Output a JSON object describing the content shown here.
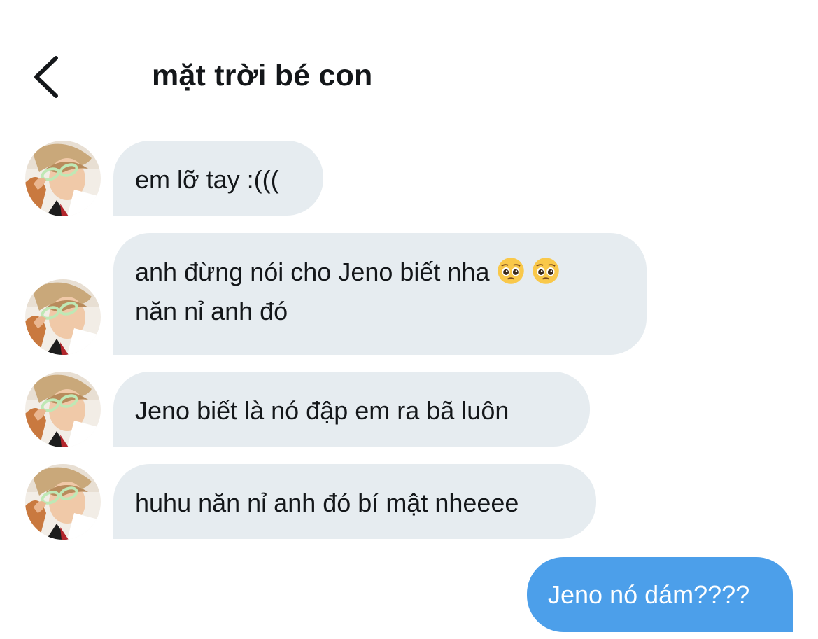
{
  "header": {
    "back_icon": "chevron-left-icon",
    "title": "mặt trời bé con"
  },
  "messages": [
    {
      "sender": "other",
      "lines": [
        "em lỡ tay :((("
      ]
    },
    {
      "sender": "other",
      "lines": [
        "anh đừng nói cho Jeno biết nha",
        "năn nỉ anh đó"
      ],
      "emoji": [
        "pleading-face-icon",
        "pleading-face-icon"
      ]
    },
    {
      "sender": "other",
      "lines": [
        "Jeno biết là nó đập em ra bã luôn"
      ]
    },
    {
      "sender": "other",
      "lines": [
        "huhu năn nỉ anh đó bí mật nheeee"
      ]
    },
    {
      "sender": "me",
      "lines": [
        "Jeno nó dám????"
      ]
    }
  ],
  "colors": {
    "incoming_bubble": "#e6ecf0",
    "outgoing_bubble": "#4c9fea",
    "text": "#14171a"
  }
}
